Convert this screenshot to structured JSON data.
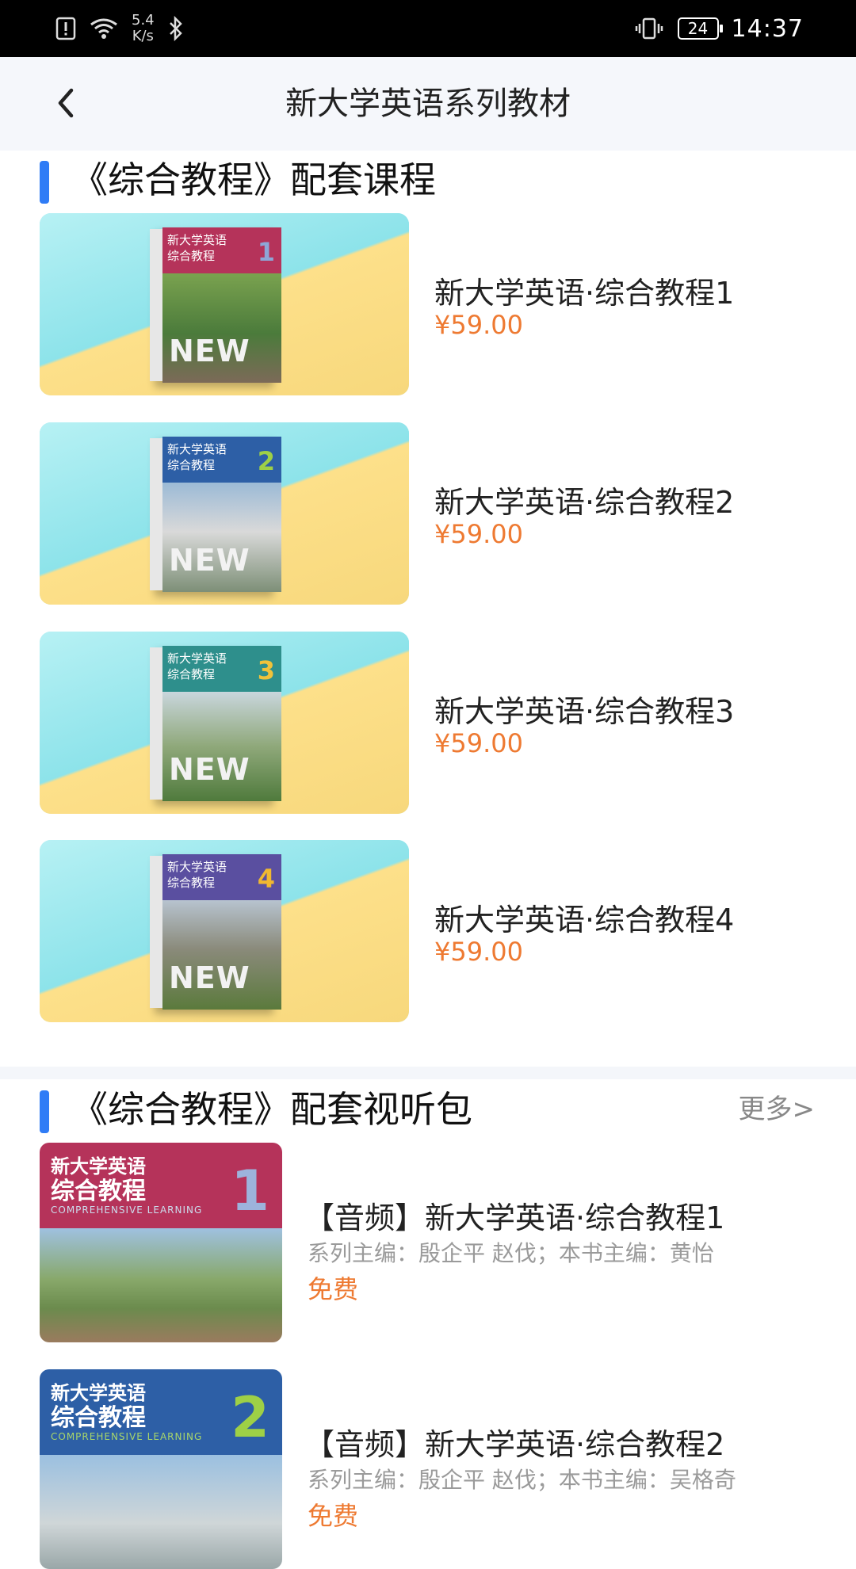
{
  "status_bar": {
    "speed_value": "5.4",
    "speed_unit": "K/s",
    "battery": "24",
    "time": "14:37"
  },
  "header": {
    "title": "新大学英语系列教材"
  },
  "section_courses": {
    "title": "《综合教程》配套课程",
    "items": [
      {
        "name": "新大学英语·综合教程1",
        "price": "¥59.00",
        "cover_num": "1"
      },
      {
        "name": "新大学英语·综合教程2",
        "price": "¥59.00",
        "cover_num": "2"
      },
      {
        "name": "新大学英语·综合教程3",
        "price": "¥59.00",
        "cover_num": "3"
      },
      {
        "name": "新大学英语·综合教程4",
        "price": "¥59.00",
        "cover_num": "4"
      }
    ]
  },
  "section_audio": {
    "title": "《综合教程》配套视听包",
    "more_label": "更多>",
    "items": [
      {
        "name": "【音频】新大学英语·综合教程1",
        "editors": "系列主编：殷企平 赵伐；本书主编：黄怡",
        "price": "免费",
        "cover_num": "1"
      },
      {
        "name": "【音频】新大学英语·综合教程2",
        "editors": "系列主编：殷企平 赵伐；本书主编：吴格奇",
        "price": "免费",
        "cover_num": "2"
      }
    ]
  },
  "cover_text": {
    "series": "新大学英语",
    "book": "综合教程",
    "english": "COMPREHENSIVE LEARNING",
    "new": "NEW"
  },
  "colors": {
    "accent_bar": "#2f7cf6",
    "price": "#ee7a32",
    "cover1": "#b5335a",
    "cover2": "#2d5fa6",
    "cover3": "#2e8f8c",
    "cover4": "#5a4fa0"
  }
}
